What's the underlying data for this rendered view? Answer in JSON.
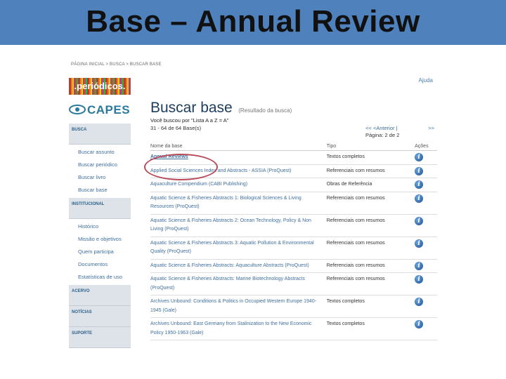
{
  "slide": {
    "title": "Base – Annual Review"
  },
  "breadcrumb": "PÁGINA INICIAL > BUSCA > BUSCAR BASE",
  "logos": {
    "periodicos": ".periódicos.",
    "capes": "CAPES"
  },
  "help": "Ajuda",
  "sidebar": {
    "sections": [
      {
        "title": "BUSCA",
        "items": [
          "Buscar assunto",
          "Buscar periódico",
          "Buscar livro",
          "Buscar base"
        ]
      },
      {
        "title": "INSTITUCIONAL",
        "items": [
          "Histórico",
          "Missão e objetivos",
          "Quem participa",
          "Documentos",
          "Estatísticas de uso"
        ]
      },
      {
        "title": "ACERVO",
        "items": []
      },
      {
        "title": "NOTÍCIAS",
        "items": []
      },
      {
        "title": "SUPORTE",
        "items": []
      }
    ]
  },
  "main": {
    "title": "Buscar base",
    "subtitle": "(Resultado da busca)",
    "searched": "Você buscou por \"Lista A a Z = A\"",
    "range": "31 - 64 de 64 Base(s)",
    "prev": "<< <Anterior |",
    "next": ">>",
    "page": "Página: 2 de 2",
    "columns": [
      "Nome da base",
      "Tipo",
      "Ações"
    ],
    "rows": [
      {
        "name": "Annual Reviews",
        "type": "Textos completos"
      },
      {
        "name": "Applied Social Sciences Index and Abstracts - ASSIA (ProQuest)",
        "type": "Referenciais com resumos"
      },
      {
        "name": "Aquaculture Compendium (CABI Publishing)",
        "type": "Obras de Referência"
      },
      {
        "name": "Aquatic Science & Fisheries Abstracts 1: Biological Sciences & Living Resources (ProQuest)",
        "type": "Referenciais com resumos"
      },
      {
        "name": "Aquatic Science & Fisheries Abstracts 2: Ocean Technology, Policy & Non Living (ProQuest)",
        "type": "Referenciais com resumos"
      },
      {
        "name": "Aquatic Science & Fisheries Abstracts 3: Aquatic Pollution & Environmental Quality (ProQuest)",
        "type": "Referenciais com resumos"
      },
      {
        "name": "Aquatic Science & Fisheries Abstracts: Aquaculture Abstracts (ProQuest)",
        "type": "Referenciais com resumos"
      },
      {
        "name": "Aquatic Science & Fisheries Abstracts: Marine Biotechnology Abstracts (ProQuest)",
        "type": "Referenciais com resumos"
      },
      {
        "name": "Archives Unbound: Conditions & Politics in Occupied Western Europe 1940-1945 (Gale)",
        "type": "Textos completos"
      },
      {
        "name": "Archives Unbound: East Germany from Stalinization to the New Economic Policy 1950-1963 (Gale)",
        "type": "Textos completos"
      }
    ]
  },
  "icons": {
    "info": "info-icon"
  },
  "colors": {
    "banner": "#4f81bd",
    "link": "#3f6f9e",
    "highlight": "#b84a5a"
  }
}
